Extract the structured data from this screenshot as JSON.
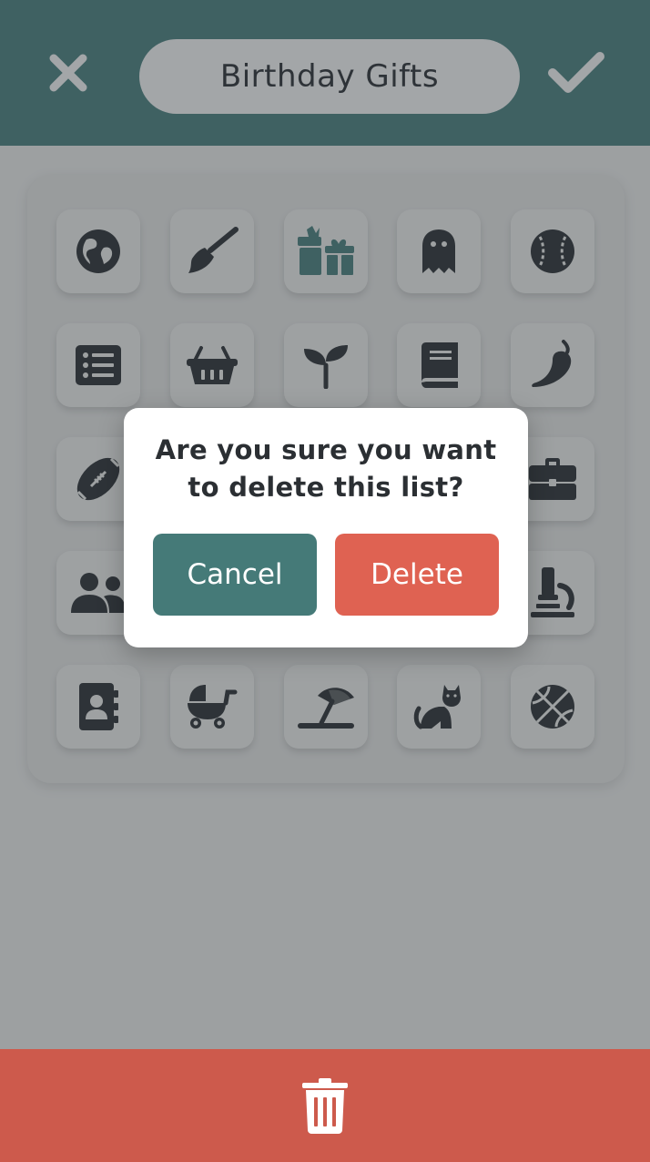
{
  "header": {
    "title": "Birthday Gifts",
    "close_icon": "close-icon",
    "confirm_icon": "checkmark-icon"
  },
  "colors": {
    "header_bg": "#4a8180",
    "selected_icon": "#4a8180",
    "icon": "#2b2f33",
    "delete": "#df6252",
    "cancel": "#457a78",
    "bottom_bar": "#cd5a4c"
  },
  "icon_grid": {
    "selected": "gift-icon",
    "rows": [
      [
        "globe-icon",
        "broom-icon",
        "gift-icon",
        "ghost-icon",
        "baseball-icon"
      ],
      [
        "list-icon",
        "basket-icon",
        "seedling-icon",
        "book-icon",
        "pepper-icon"
      ],
      [
        "football-icon",
        "",
        "",
        "",
        "briefcase-icon"
      ],
      [
        "users-icon",
        "",
        "",
        "",
        "microscope-icon"
      ],
      [
        "address-book-icon",
        "baby-carriage-icon",
        "umbrella-beach-icon",
        "cat-icon",
        "basketball-icon"
      ]
    ]
  },
  "dialog": {
    "message": "Are you sure you want to delete this list?",
    "cancel_label": "Cancel",
    "delete_label": "Delete"
  },
  "bottom_bar": {
    "icon": "trash-icon"
  }
}
